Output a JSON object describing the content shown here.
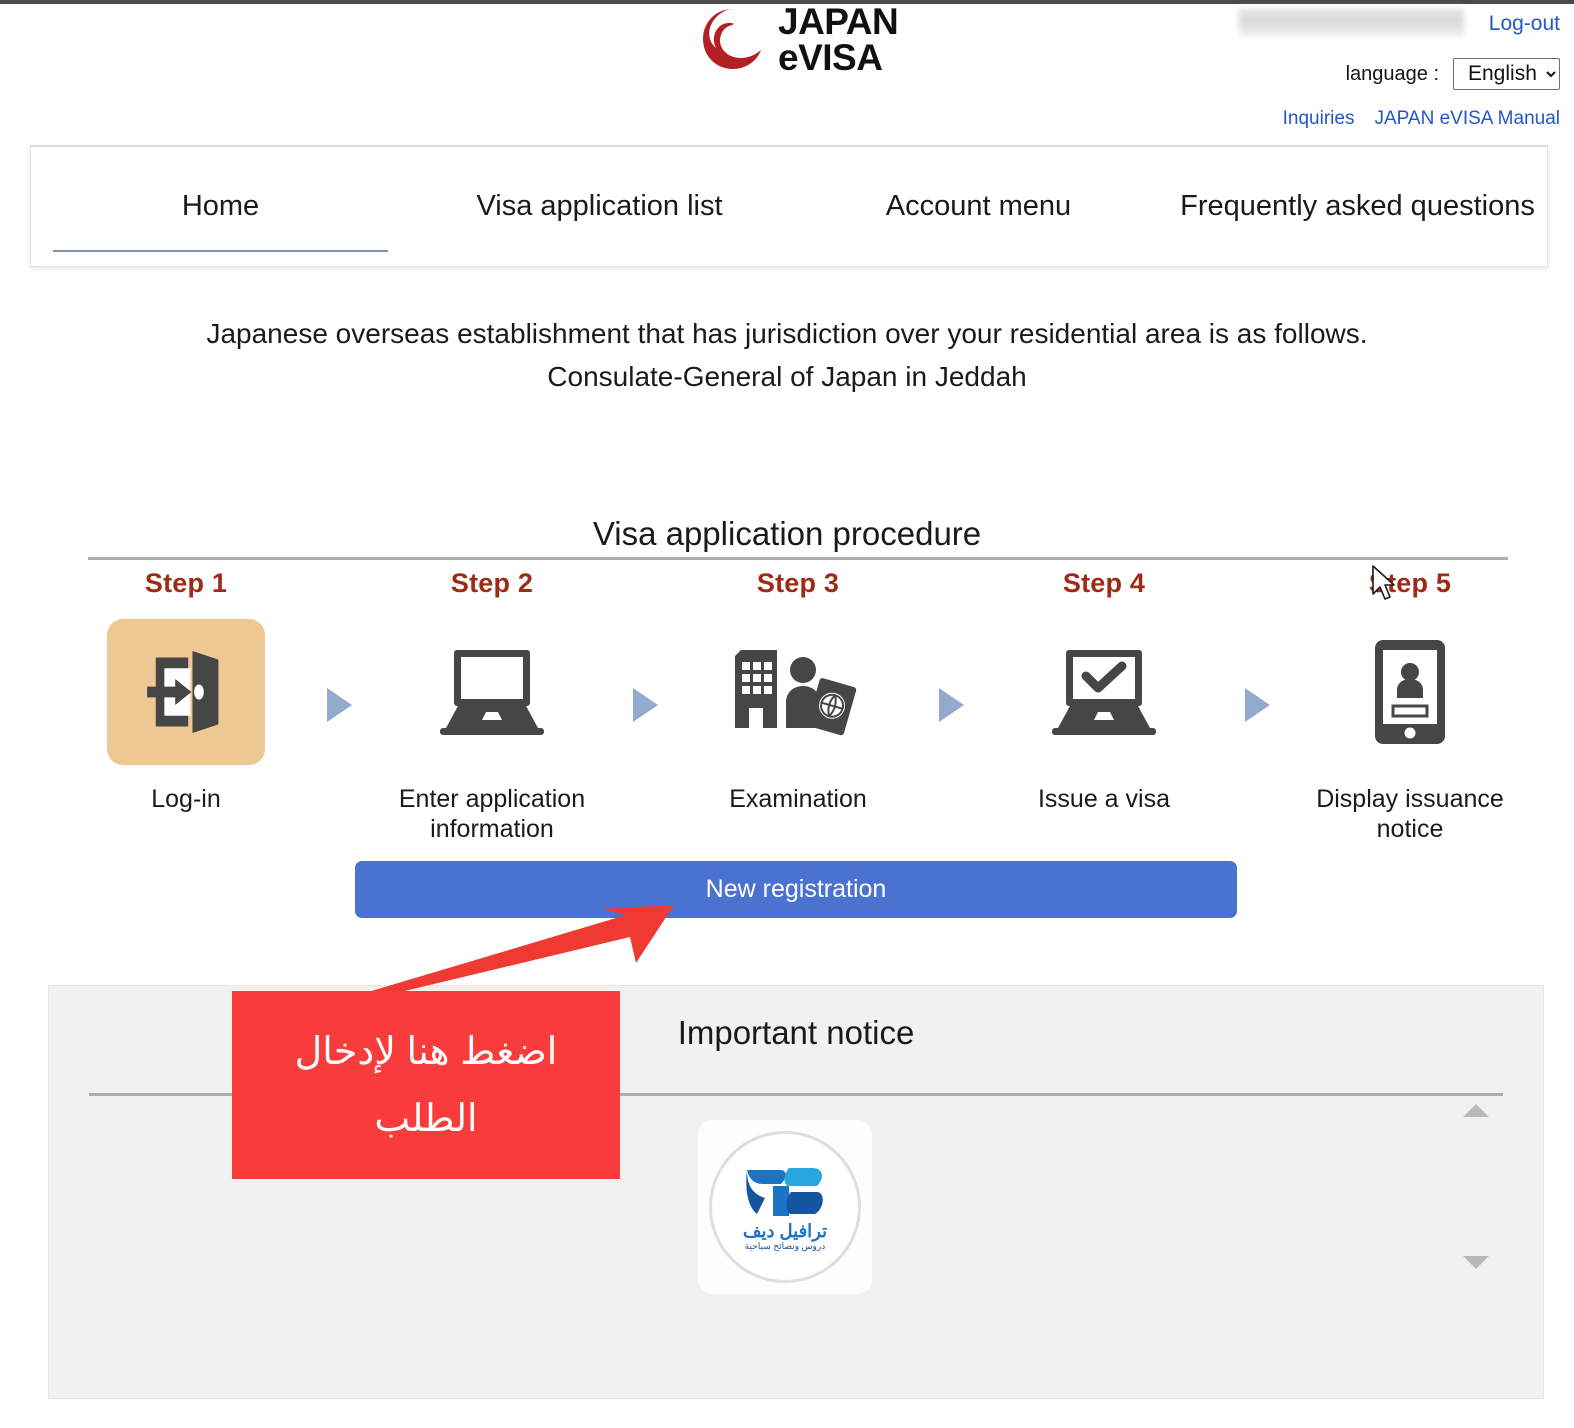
{
  "header": {
    "logo_line1": "JAPAN",
    "logo_line2": "eVISA",
    "logo_icon": "japan-evisa-logo-icon",
    "logout_label": "Log-out",
    "username_redacted": "",
    "language_label": "language :",
    "language_selected": "English",
    "language_options": [
      "English"
    ],
    "links": [
      {
        "label": "Inquiries"
      },
      {
        "label": "JAPAN eVISA Manual"
      }
    ]
  },
  "nav": {
    "items": [
      {
        "label": "Home",
        "active": true
      },
      {
        "label": "Visa application list",
        "active": false
      },
      {
        "label": "Account menu",
        "active": false
      },
      {
        "label": "Frequently asked questions",
        "active": false
      }
    ]
  },
  "intro": {
    "line1": "Japanese overseas establishment that has jurisdiction over your residential area is as follows.",
    "line2": "Consulate-General of Japan in Jeddah"
  },
  "procedure": {
    "title": "Visa application procedure",
    "steps": [
      {
        "step_label": "Step 1",
        "caption": "Log-in",
        "icon": "door-login-icon",
        "highlighted": true
      },
      {
        "step_label": "Step 2",
        "caption": "Enter application information",
        "icon": "laptop-icon",
        "highlighted": false
      },
      {
        "step_label": "Step 3",
        "caption": "Examination",
        "icon": "building-passport-icon",
        "highlighted": false
      },
      {
        "step_label": "Step 4",
        "caption": "Issue a visa",
        "icon": "laptop-check-icon",
        "highlighted": false
      },
      {
        "step_label": "Step 5",
        "caption": "Display issuance notice",
        "icon": "smartphone-id-icon",
        "highlighted": false
      }
    ],
    "cta_label": "New registration"
  },
  "notice": {
    "title": "Important notice",
    "scroll_up_icon": "scroll-up-arrow-icon",
    "scroll_down_icon": "scroll-down-arrow-icon",
    "watermark": {
      "name_ar": "ترافيل ديف",
      "tagline_ar": "دروس ونصائح سياحية"
    }
  },
  "annotation": {
    "line1": "اضغط هنا لإدخال",
    "line2": "الطلب",
    "arrow_icon": "red-pointer-arrow-icon",
    "color": "#f83b3b"
  },
  "cursor": {
    "icon": "mouse-cursor-icon"
  },
  "colors": {
    "accent_red": "#9e2b17",
    "cta_blue": "#4a72d0",
    "link_blue": "#2456c9",
    "step_highlight": "#edc892",
    "arrow_blue": "#93a9cd",
    "annotation_red": "#f83b3b",
    "panel_gray": "#f1f1f1"
  }
}
